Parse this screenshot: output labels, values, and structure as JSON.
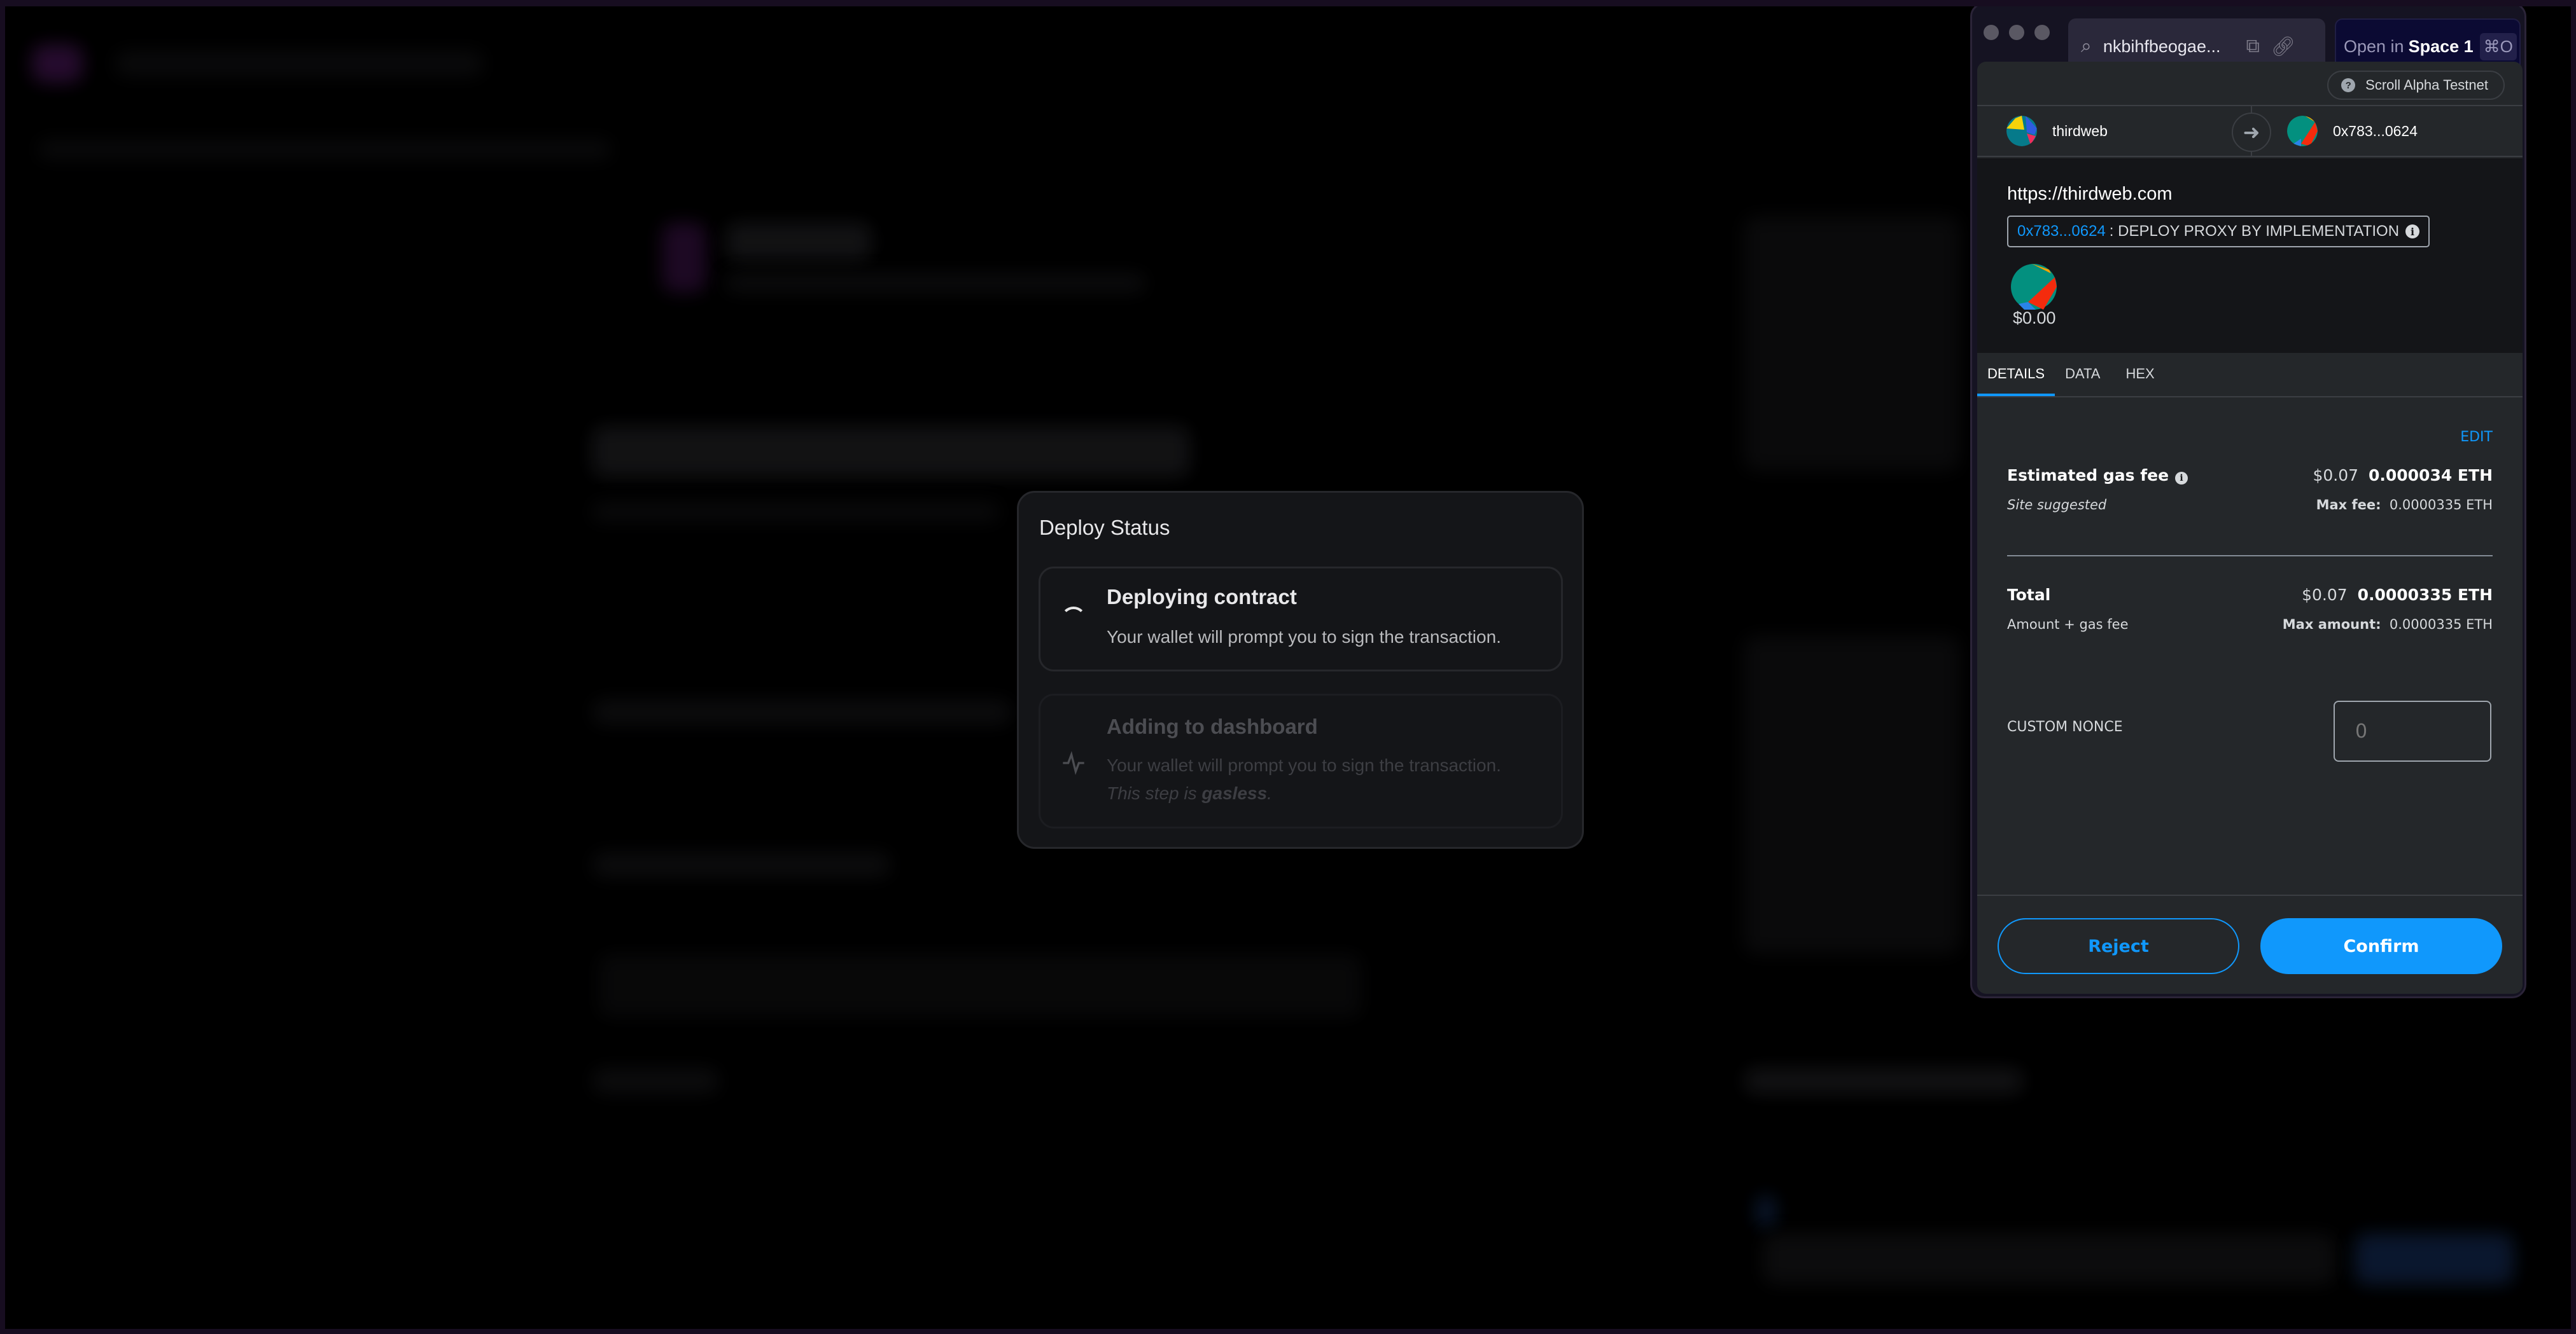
{
  "deploy_dialog": {
    "title": "Deploy Status",
    "steps": [
      {
        "title": "Deploying contract",
        "description": "Your wallet will prompt you to sign the transaction.",
        "icon": "spinner-icon",
        "state": "in-progress"
      },
      {
        "title": "Adding to dashboard",
        "description": "Your wallet will prompt you to sign the transaction.",
        "note_prefix": "This step is ",
        "note_emphasis": "gasless",
        "note_suffix": ".",
        "icon": "activity-icon",
        "state": "pending"
      }
    ]
  },
  "browser": {
    "url": "nkbihfbeogae...",
    "open_in_label": "Open in",
    "space_label": "Space 1",
    "shortcut": "⌘O"
  },
  "wallet": {
    "network": "Scroll Alpha Testnet",
    "from_account": "thirdweb",
    "to_account": "0x783...0624",
    "origin": "https://thirdweb.com",
    "method_address": "0x783...0624",
    "method_name": ": DEPLOY PROXY BY IMPLEMENTATION",
    "amount": "$0.00",
    "tabs": [
      "DETAILS",
      "DATA",
      "HEX"
    ],
    "active_tab": "DETAILS",
    "edit_label": "EDIT",
    "gas": {
      "label": "Estimated gas fee",
      "fiat": "$0.07",
      "eth": "0.000034 ETH",
      "sub_label": "Site suggested",
      "max_label": "Max fee:",
      "max_value": "0.0000335 ETH"
    },
    "total": {
      "label": "Total",
      "fiat": "$0.07",
      "eth": "0.0000335 ETH",
      "sub_label": "Amount + gas fee",
      "max_label": "Max amount:",
      "max_value": "0.0000335 ETH"
    },
    "custom_nonce_label": "CUSTOM NONCE",
    "custom_nonce_placeholder": "0",
    "reject_label": "Reject",
    "confirm_label": "Confirm",
    "accent_color": "#1098fc"
  }
}
